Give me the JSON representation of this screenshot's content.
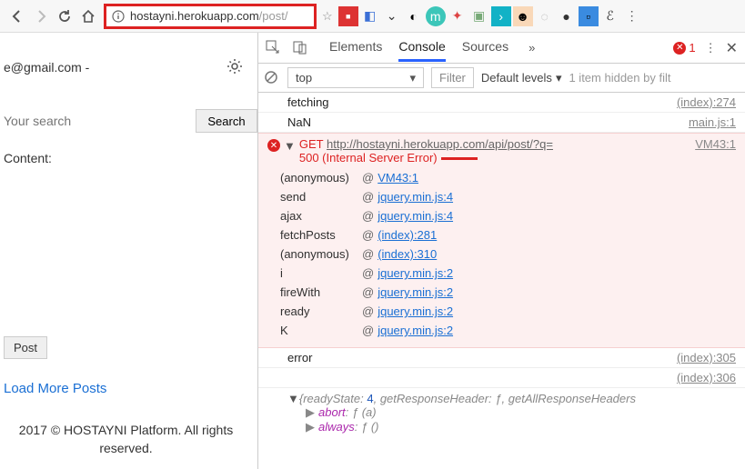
{
  "browser": {
    "url_host": "hostayni.herokuapp.com",
    "url_path": "/post/"
  },
  "left": {
    "email_suffix": "e@gmail.com -",
    "search_placeholder": "Your search",
    "search_btn": "Search",
    "content_label": "Content:",
    "post_btn": "Post",
    "load_more": "Load More Posts",
    "footer": "2017 © HOSTAYNI Platform. All rights reserved."
  },
  "devtools": {
    "tabs": [
      "Elements",
      "Console",
      "Sources"
    ],
    "active_tab": "Console",
    "error_count": "1",
    "context": "top",
    "filter_placeholder": "Filter",
    "levels": "Default levels",
    "hidden": "1 item hidden by filt"
  },
  "logs": [
    {
      "msg": "fetching",
      "src": "(index):274"
    },
    {
      "msg": "NaN",
      "src": "main.js:1"
    }
  ],
  "error": {
    "method": "GET",
    "url": "http://hostayni.herokuapp.com/api/post/?q=",
    "status": "500 (Internal Server Error)",
    "src": "VM43:1",
    "stack": [
      {
        "fn": "(anonymous)",
        "loc": "VM43:1"
      },
      {
        "fn": "send",
        "loc": "jquery.min.js:4"
      },
      {
        "fn": "ajax",
        "loc": "jquery.min.js:4"
      },
      {
        "fn": "fetchPosts",
        "loc": "(index):281"
      },
      {
        "fn": "(anonymous)",
        "loc": "(index):310"
      },
      {
        "fn": "i",
        "loc": "jquery.min.js:2"
      },
      {
        "fn": "fireWith",
        "loc": "jquery.min.js:2"
      },
      {
        "fn": "ready",
        "loc": "jquery.min.js:2"
      },
      {
        "fn": "K",
        "loc": "jquery.min.js:2"
      }
    ]
  },
  "logs2": [
    {
      "msg": "error",
      "src": "(index):305"
    },
    {
      "msg": "",
      "src": "(index):306"
    }
  ],
  "obj": {
    "head_a": "readyState:",
    "head_a_val": "4",
    "head_b": "getResponseHeader:",
    "head_b_val": "ƒ",
    "head_c": "getAllResponseHeaders",
    "props": [
      {
        "name": "abort",
        "sig": "ƒ (a)"
      },
      {
        "name": "always",
        "sig": "ƒ ()"
      }
    ]
  }
}
